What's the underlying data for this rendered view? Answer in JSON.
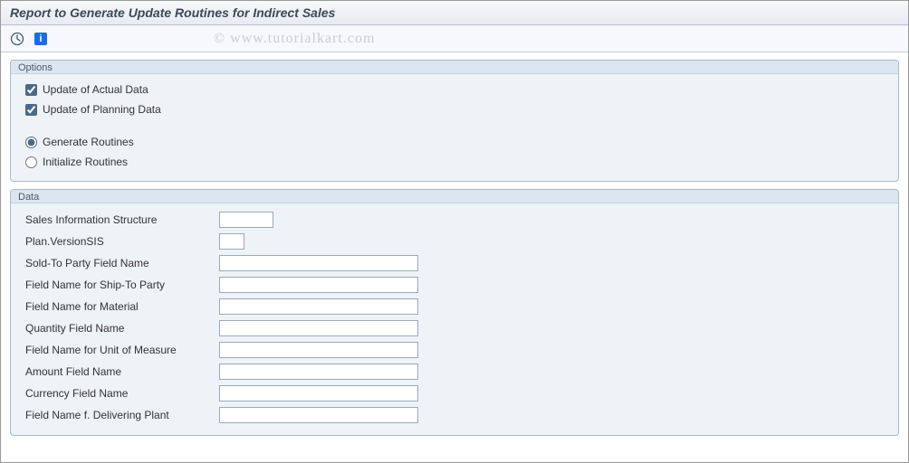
{
  "title": "Report to Generate Update Routines for Indirect Sales",
  "watermark": "© www.tutorialkart.com",
  "options": {
    "group_label": "Options",
    "actual": {
      "label": "Update of Actual Data",
      "checked": true
    },
    "planning": {
      "label": "Update of Planning Data",
      "checked": true
    },
    "routines": {
      "generate": {
        "label": "Generate Routines",
        "selected": true
      },
      "initialize": {
        "label": "Initialize Routines",
        "selected": false
      }
    }
  },
  "data": {
    "group_label": "Data",
    "fields": {
      "sis": {
        "label": "Sales Information Structure",
        "value": "",
        "width": "sm"
      },
      "plan_version": {
        "label": "Plan.VersionSIS",
        "value": "",
        "width": "xs"
      },
      "sold_to": {
        "label": "Sold-To Party Field Name",
        "value": "",
        "width": "lg"
      },
      "ship_to": {
        "label": "Field Name for Ship-To Party",
        "value": "",
        "width": "lg"
      },
      "material": {
        "label": "Field Name for Material",
        "value": "",
        "width": "lg"
      },
      "quantity": {
        "label": "Quantity Field Name",
        "value": "",
        "width": "lg"
      },
      "uom": {
        "label": "Field Name for Unit of Measure",
        "value": "",
        "width": "lg"
      },
      "amount": {
        "label": "Amount Field Name",
        "value": "",
        "width": "lg"
      },
      "currency": {
        "label": "Currency Field Name",
        "value": "",
        "width": "lg"
      },
      "plant": {
        "label": "Field Name f. Delivering Plant",
        "value": "",
        "width": "lg"
      }
    }
  }
}
